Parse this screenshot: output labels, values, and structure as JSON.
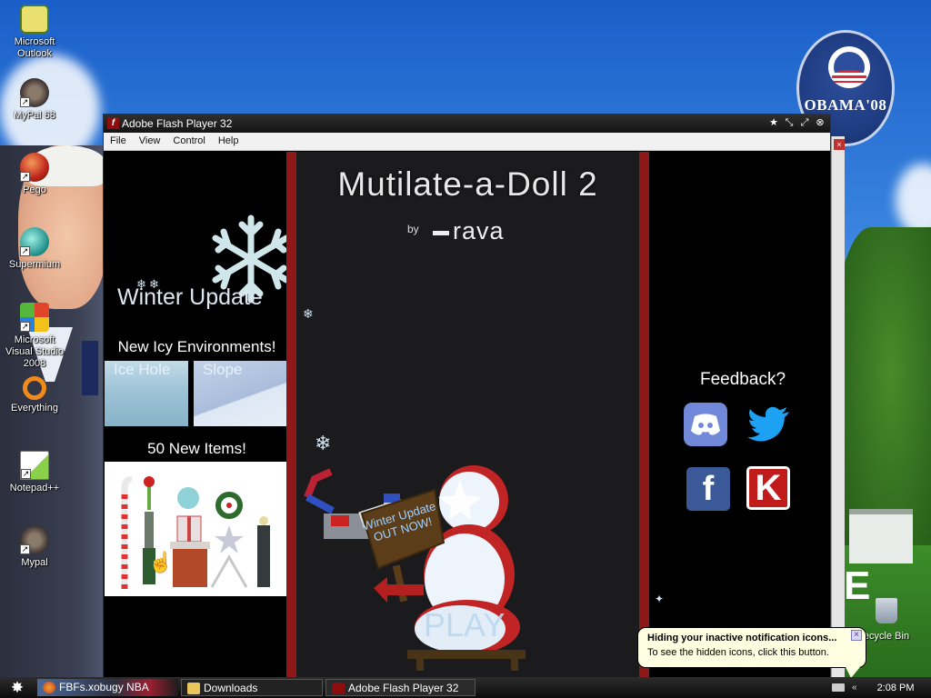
{
  "desktop": {
    "icons": [
      {
        "label": "Microsoft Outlook",
        "icon": "outlook-icon"
      },
      {
        "label": "MyPal 68",
        "icon": "raccoon-icon"
      },
      {
        "label": "Pego",
        "icon": "pego-icon"
      },
      {
        "label": "Supermium",
        "icon": "supermium-icon"
      },
      {
        "label": "Microsoft Visual Studio 2008",
        "icon": "visual-studio-icon"
      },
      {
        "label": "Everything",
        "icon": "everything-icon"
      },
      {
        "label": "Notepad++",
        "icon": "notepad-plus-plus-icon"
      },
      {
        "label": "Mypal",
        "icon": "raccoon-icon"
      }
    ],
    "recycle_bin_label": "ecycle Bin",
    "badge_text": "OBAMA'08"
  },
  "flash_window": {
    "title": "Adobe Flash Player 32",
    "menu": [
      "File",
      "View",
      "Control",
      "Help"
    ],
    "game": {
      "title": "Mutilate-a-Doll 2",
      "by": "by",
      "author": "rava",
      "winter_update": "Winter Update",
      "icy_environments": "New Icy Environments!",
      "environments": [
        "Ice Hole",
        "Slope"
      ],
      "new_items": "50 New Items!",
      "sign_text": "Winter Update OUT NOW!",
      "play": "PLAY",
      "feedback": "Feedback?",
      "social": [
        "discord-icon",
        "twitter-icon",
        "facebook-icon",
        "kongregate-icon"
      ],
      "facebook_glyph": "f",
      "kongregate_glyph": "K"
    }
  },
  "notification": {
    "title": "Hiding your inactive notification icons...",
    "body": "To see the hidden icons, click this button."
  },
  "taskbar": {
    "tasks": [
      {
        "label": "FBFs.xobugy NBA"
      },
      {
        "label": "Downloads"
      },
      {
        "label": "Adobe Flash Player 32"
      }
    ],
    "time": "2:08 PM"
  },
  "colors": {
    "game_red": "#8e1717",
    "game_bg": "#1b1b1d",
    "discord": "#7289da",
    "facebook": "#3b5998",
    "kongregate": "#c01c1c",
    "twitter": "#1da1f2"
  }
}
